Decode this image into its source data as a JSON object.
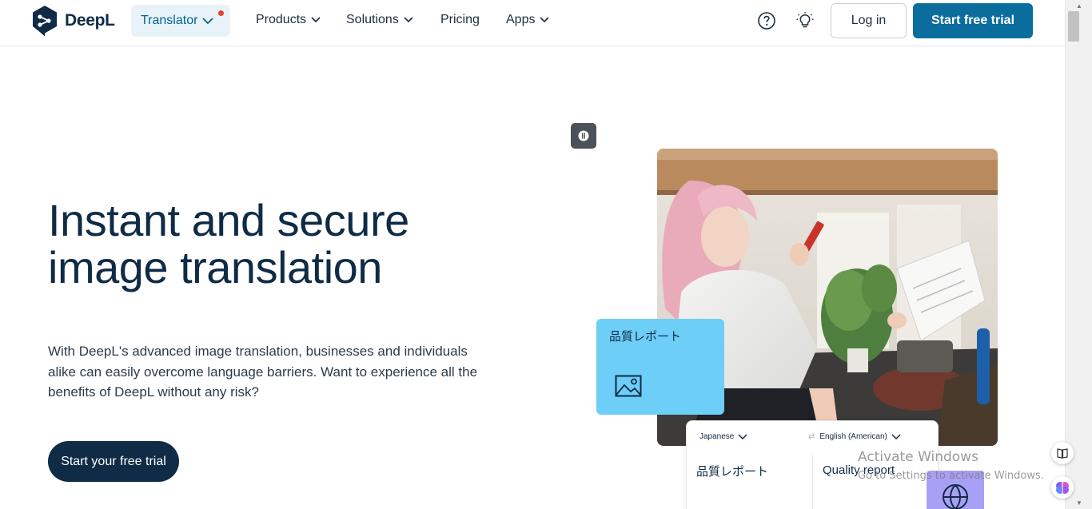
{
  "nav": {
    "brand": "DeepL",
    "translator_label": "Translator",
    "menu": [
      {
        "label": "Products"
      },
      {
        "label": "Solutions"
      },
      {
        "label": "Pricing"
      },
      {
        "label": "Apps"
      }
    ],
    "help_icon": "question-circle-icon",
    "tips_icon": "lightbulb-icon",
    "login_label": "Log in",
    "trial_label": "Start free trial"
  },
  "hero": {
    "title_line1": "Instant and secure",
    "title_line2": "image translation",
    "description": "With DeepL's advanced image translation, businesses and individuals alike can easily overcome language barriers. Want to experience all the benefits of DeepL without any risk?",
    "cta_label": "Start your free trial"
  },
  "visual": {
    "card_text": "品質レポート",
    "from_lang": "Japanese",
    "to_lang": "English (American)",
    "source_text": "品質レポート",
    "target_text": "Quality report"
  },
  "overlay": {
    "activate_title": "Activate Windows",
    "activate_sub": "Go to Settings to activate Windows."
  },
  "colors": {
    "brand_navy": "#0f2b46",
    "accent_blue": "#0b6d9d",
    "card_blue": "#6dcef8",
    "purple": "#a8a0f5"
  }
}
